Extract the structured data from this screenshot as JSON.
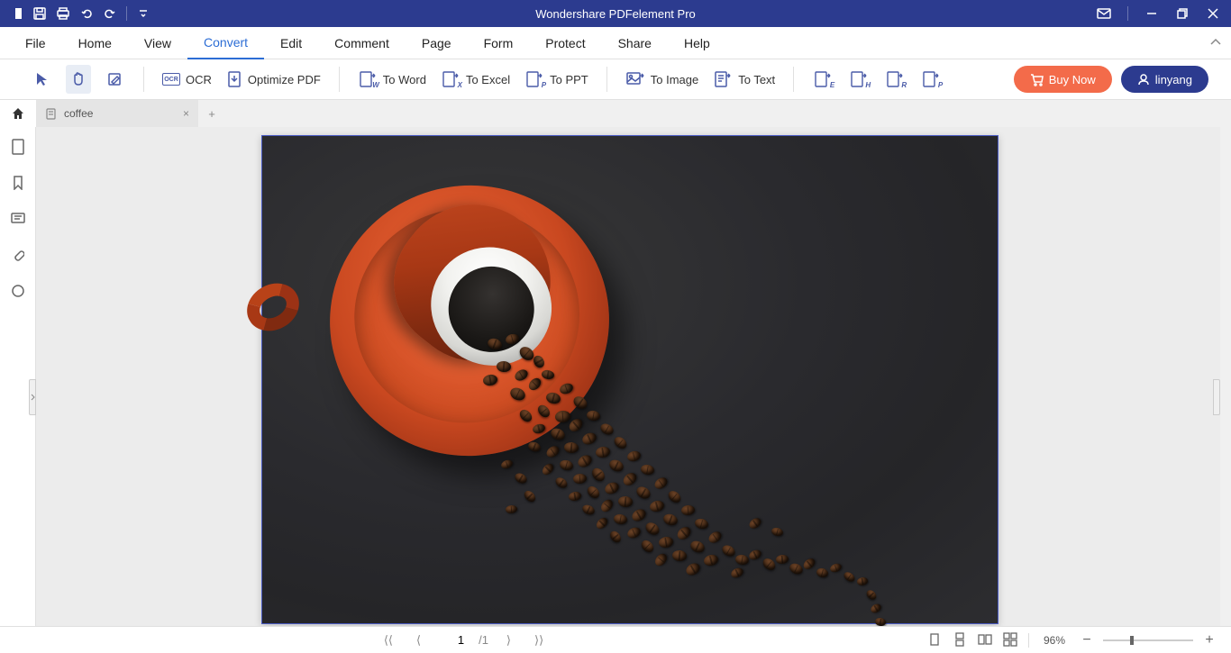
{
  "app": {
    "title": "Wondershare PDFelement Pro"
  },
  "menu": {
    "items": [
      "File",
      "Home",
      "View",
      "Convert",
      "Edit",
      "Comment",
      "Page",
      "Form",
      "Protect",
      "Share",
      "Help"
    ],
    "active": "Convert"
  },
  "ribbon": {
    "ocr": "OCR",
    "optimize": "Optimize PDF",
    "to_word": "To Word",
    "to_excel": "To Excel",
    "to_ppt": "To PPT",
    "to_image": "To Image",
    "to_text": "To Text",
    "export_letters": [
      "E",
      "H",
      "R",
      "P"
    ],
    "buy": "Buy Now",
    "user": "linyang"
  },
  "tabs": {
    "doc_name": "coffee"
  },
  "pager": {
    "current": "1",
    "total": "/1"
  },
  "zoom": {
    "value": "96%"
  }
}
